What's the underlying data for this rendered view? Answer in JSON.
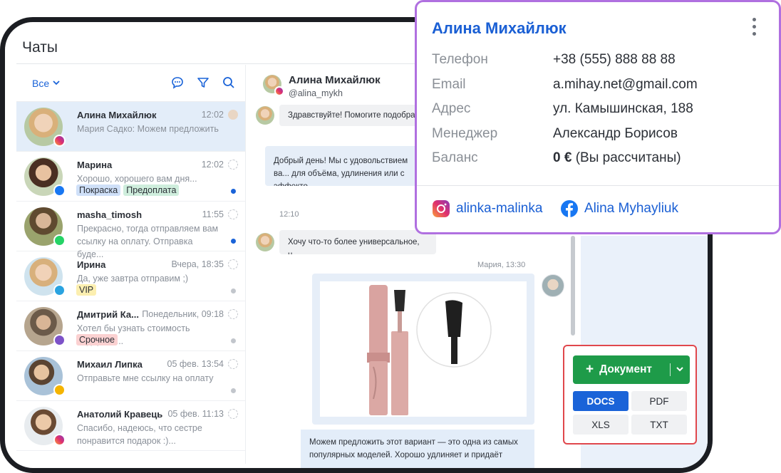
{
  "app": {
    "title": "Чаты"
  },
  "sidebar": {
    "filter_label": "Все",
    "chats": [
      {
        "name": "Алина Михайлюк",
        "time": "12:02",
        "preview": "Мария Садко: Можем предложить",
        "tags": [],
        "source": "instagram",
        "active": true
      },
      {
        "name": "Марина",
        "time": "12:02",
        "preview": "Хорошо, хорошего вам дня...",
        "tags": [
          "Покраска",
          "Предоплата"
        ],
        "source": "facebook",
        "unread": true
      },
      {
        "name": "masha_timosh",
        "time": "11:55",
        "preview": "Прекрасно, тогда отправляем вам ссылку на оплату. Отправка буде...",
        "tags": [],
        "source": "whatsapp",
        "unread": true
      },
      {
        "name": "Ирина",
        "time": "Вчера, 18:35",
        "preview": "Да, уже завтра отправим ;)",
        "tags": [
          "VIP"
        ],
        "source": "telegram"
      },
      {
        "name": "Дмитрий Ка...",
        "time": "Понедельник, 09:18",
        "preview": "Хотел бы узнать стоимость подарочн...",
        "tags": [
          "Срочное"
        ],
        "source": "viber"
      },
      {
        "name": "Михаил Липка",
        "time": "05 фев. 13:54",
        "preview": "Отправьте мне ссылку на оплату",
        "tags": [],
        "source": "other"
      },
      {
        "name": "Анатолий Кравець",
        "time": "05 фев. 11:13",
        "preview": "Спасибо, надеюсь, что сестре понравится подарок :)...",
        "tags": [],
        "source": "instagram"
      }
    ]
  },
  "chat": {
    "header_name": "Алина Михайлюк",
    "header_user": "@alina_mykh",
    "messages": [
      {
        "text": "Здравствуйте! Помогите подобрать"
      },
      {
        "text": "Добрый день! Мы с удовольствием ва... для объёма, удлинения или с эффекто..."
      },
      {
        "time": "12:10"
      },
      {
        "text": "Хочу что-то более универсальное, н..."
      },
      {
        "author_time": "Мария, 13:30"
      },
      {
        "text": "Можем предложить этот вариант — это одна из самых популярных моделей. Хорошо удлиняет и придаёт"
      }
    ]
  },
  "document": {
    "button_label": "Документ",
    "formats": [
      "DOCS",
      "PDF",
      "XLS",
      "TXT"
    ],
    "active_format": "DOCS"
  },
  "contact_card": {
    "name": "Алина Михайлюк",
    "fields": [
      {
        "label": "Телефон",
        "value": "+38 (555) 888 88 88"
      },
      {
        "label": "Email",
        "value": "a.mihay.net@gmail.com"
      },
      {
        "label": "Адрес",
        "value": "ул. Камышинская, 188"
      },
      {
        "label": "Менеджер",
        "value": "Александр Борисов"
      },
      {
        "label": "Баланс",
        "value_bold": "0 €",
        "value_rest": " (Вы рассчитаны)"
      }
    ],
    "instagram": "alinka-malinka",
    "facebook": "Alina Myhayliuk"
  },
  "colors": {
    "accent": "#1a63d8",
    "green": "#1e9b49",
    "highlight_border": "#e0474c",
    "card_border": "#b070e0"
  }
}
